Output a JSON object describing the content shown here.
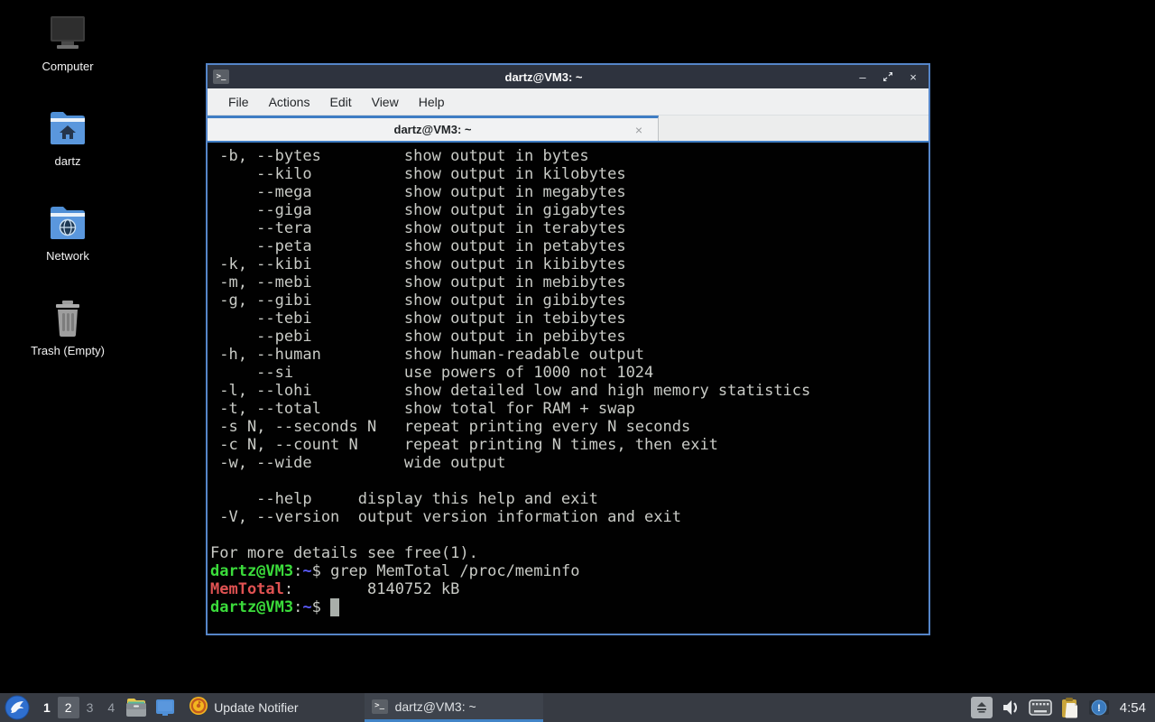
{
  "desktop": {
    "icons": [
      {
        "label": "Computer"
      },
      {
        "label": "dartz"
      },
      {
        "label": "Network"
      },
      {
        "label": "Trash (Empty)"
      }
    ]
  },
  "window": {
    "title": "dartz@VM3: ~",
    "controls": {
      "minimize": "–",
      "close": "×"
    },
    "menu": [
      "File",
      "Actions",
      "Edit",
      "View",
      "Help"
    ],
    "tab": {
      "title": "dartz@VM3: ~",
      "close": "×"
    }
  },
  "terminal": {
    "colors": {
      "background": "#010101",
      "foreground": "#c9cbc6",
      "prompt_green": "#3bdc3b",
      "path_blue": "#5c5cff",
      "match_red": "#e05252"
    },
    "lines": [
      [
        [
          " -b, --bytes         show output in bytes",
          "fg"
        ]
      ],
      [
        [
          "     --kilo          show output in kilobytes",
          "fg"
        ]
      ],
      [
        [
          "     --mega          show output in megabytes",
          "fg"
        ]
      ],
      [
        [
          "     --giga          show output in gigabytes",
          "fg"
        ]
      ],
      [
        [
          "     --tera          show output in terabytes",
          "fg"
        ]
      ],
      [
        [
          "     --peta          show output in petabytes",
          "fg"
        ]
      ],
      [
        [
          " -k, --kibi          show output in kibibytes",
          "fg"
        ]
      ],
      [
        [
          " -m, --mebi          show output in mebibytes",
          "fg"
        ]
      ],
      [
        [
          " -g, --gibi          show output in gibibytes",
          "fg"
        ]
      ],
      [
        [
          "     --tebi          show output in tebibytes",
          "fg"
        ]
      ],
      [
        [
          "     --pebi          show output in pebibytes",
          "fg"
        ]
      ],
      [
        [
          " -h, --human         show human-readable output",
          "fg"
        ]
      ],
      [
        [
          "     --si            use powers of 1000 not 1024",
          "fg"
        ]
      ],
      [
        [
          " -l, --lohi          show detailed low and high memory statistics",
          "fg"
        ]
      ],
      [
        [
          " -t, --total         show total for RAM + swap",
          "fg"
        ]
      ],
      [
        [
          " -s N, --seconds N   repeat printing every N seconds",
          "fg"
        ]
      ],
      [
        [
          " -c N, --count N     repeat printing N times, then exit",
          "fg"
        ]
      ],
      [
        [
          " -w, --wide          wide output",
          "fg"
        ]
      ],
      [],
      [
        [
          "     --help     display this help and exit",
          "fg"
        ]
      ],
      [
        [
          " -V, --version  output version information and exit",
          "fg"
        ]
      ],
      [],
      [
        [
          "For more details see free(1).",
          "fg"
        ]
      ],
      [
        [
          "dartz@VM3",
          "green"
        ],
        [
          ":",
          "fg"
        ],
        [
          "~",
          "blue"
        ],
        [
          "$ ",
          "fg"
        ],
        [
          "grep MemTotal /proc/meminfo",
          "fg"
        ]
      ],
      [
        [
          "MemTotal",
          "red"
        ],
        [
          ":",
          "fg"
        ],
        [
          "        8140752 kB",
          "fg"
        ]
      ],
      [
        [
          "dartz@VM3",
          "green"
        ],
        [
          ":",
          "fg"
        ],
        [
          "~",
          "blue"
        ],
        [
          "$ ",
          "fg"
        ],
        [
          " ",
          "cursor"
        ]
      ]
    ]
  },
  "taskbar": {
    "workspaces": [
      "1",
      "2",
      "3",
      "4"
    ],
    "current_workspace": "2",
    "update_notifier_label": "Update Notifier",
    "task_label": "dartz@VM3: ~",
    "clock": "4:54"
  },
  "icon_names": {
    "terminal_glyph": ">_"
  }
}
